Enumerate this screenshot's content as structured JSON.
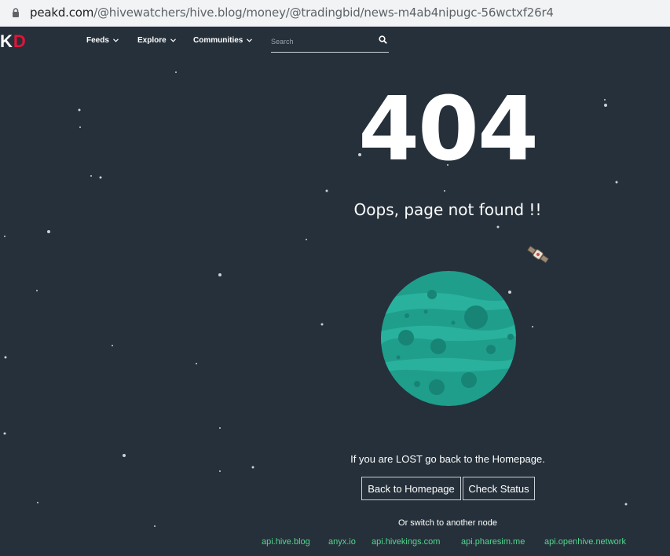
{
  "browser": {
    "url_host": "peakd.com",
    "url_path": "/@hivewatchers/hive.blog/money/@tradingbid/news-m4ab4nipugc-56wctxf26r4"
  },
  "nav": {
    "logo_k": "K",
    "logo_d": "D",
    "items": [
      "Feeds",
      "Explore",
      "Communities"
    ],
    "search_placeholder": "Search"
  },
  "error": {
    "code": "404",
    "message": "Oops, page not found !!",
    "lost_text": "If you are LOST go back to the Homepage.",
    "back_button": "Back to Homepage",
    "status_button": "Check Status",
    "switch_text": "Or switch to another node",
    "nodes": [
      "api.hive.blog",
      "anyx.io",
      "api.hivekings.com",
      "api.pharesim.me",
      "api.openhive.network"
    ]
  },
  "colors": {
    "background": "#25303a",
    "brand_red": "#e31337",
    "node_link": "#56d68e",
    "planet": "#1f9e8c"
  }
}
